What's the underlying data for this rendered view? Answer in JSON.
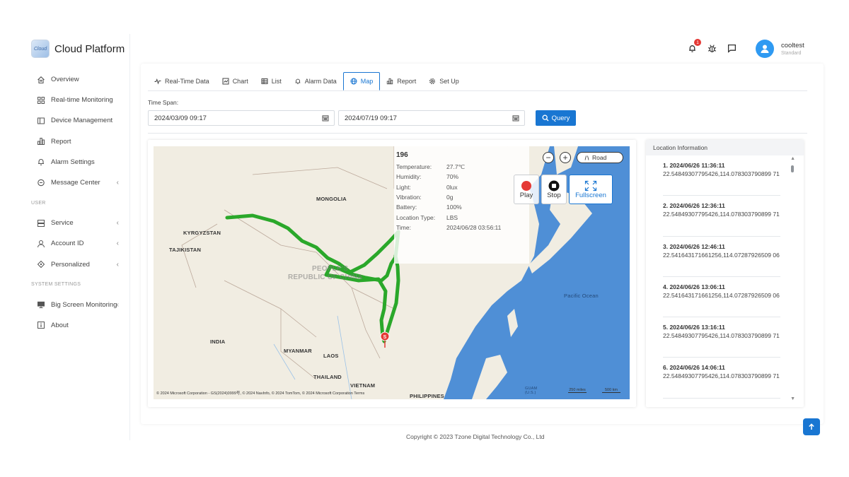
{
  "app": {
    "title": "Cloud Platform",
    "logo_text": "Cloud"
  },
  "sidebar": {
    "items": [
      {
        "label": "Overview",
        "icon": "home-icon"
      },
      {
        "label": "Real-time Monitoring",
        "icon": "grid-icon"
      },
      {
        "label": "Device Management",
        "icon": "device-icon"
      },
      {
        "label": "Report",
        "icon": "bar-chart-icon"
      },
      {
        "label": "Alarm Settings",
        "icon": "bell-icon"
      },
      {
        "label": "Message Center",
        "icon": "message-icon"
      }
    ],
    "section_user": "USER",
    "user_items": [
      {
        "label": "Service",
        "icon": "server-icon"
      },
      {
        "label": "Account ID",
        "icon": "person-icon"
      },
      {
        "label": "Personalized",
        "icon": "brush-icon"
      }
    ],
    "section_system": "SYSTEM SETTINGS",
    "system_items": [
      {
        "label": "Big Screen Monitoring",
        "icon": "monitor-icon"
      },
      {
        "label": "About",
        "icon": "info-icon"
      }
    ]
  },
  "header": {
    "notification_count": "1",
    "user_name": "cooltest",
    "user_role": "Standard"
  },
  "tabs": [
    {
      "label": "Real-Time Data",
      "icon": "pulse-icon"
    },
    {
      "label": "Chart",
      "icon": "chart-icon"
    },
    {
      "label": "List",
      "icon": "table-icon"
    },
    {
      "label": "Alarm Data",
      "icon": "bell-icon"
    },
    {
      "label": "Map",
      "icon": "globe-icon",
      "active": true
    },
    {
      "label": "Report",
      "icon": "bar-chart-icon"
    },
    {
      "label": "Set Up",
      "icon": "gear-icon"
    }
  ],
  "filter": {
    "time_span_label": "Time Span:",
    "start": "2024/03/09 09:17",
    "end": "2024/07/19 09:17",
    "query_label": "Query"
  },
  "map": {
    "road_label": "Road",
    "play_label": "Play",
    "stop_label": "Stop",
    "fullscreen_label": "Fullscreen",
    "start_marker": "S",
    "labels": {
      "mongolia": "MONGOLIA",
      "kyrgyzstan": "KYRGYZSTAN",
      "tajikistan": "TAJIKISTAN",
      "china_1": "PEOPLE'S",
      "china_2": "REPUBLIC OF CHINA",
      "india": "INDIA",
      "myanmar": "MYANMAR",
      "laos": "LAOS",
      "thailand": "THAILAND",
      "vietnam": "VIETNAM",
      "philippines": "PHILIPPINES",
      "pacific": "Pacific Ocean",
      "guam": "GUAM (U.S.)"
    },
    "attribution": "© 2024 Microsoft Corporation - GS(2024)0999号, © 2024 NavInfo, © 2024 TomTom, © 2024 Microsoft Corporation  Terms",
    "scale_miles": "250 miles",
    "scale_km": "500 km",
    "popup": {
      "id": "196",
      "rows": [
        {
          "k": "Temperature:",
          "v": "27.7℃"
        },
        {
          "k": "Humidity:",
          "v": "70%"
        },
        {
          "k": "Light:",
          "v": "0lux"
        },
        {
          "k": "Vibration:",
          "v": "0g"
        },
        {
          "k": "Battery:",
          "v": "100%"
        },
        {
          "k": "Location Type:",
          "v": "LBS"
        },
        {
          "k": "Time:",
          "v": "2024/06/28 03:56:11"
        }
      ]
    },
    "colors": {
      "water": "#4f8fd6",
      "land": "#f1ede2",
      "track": "#2aa82a"
    }
  },
  "location_info": {
    "title": "Location Information",
    "items": [
      {
        "time": "1. 2024/06/26 11:36:11",
        "coord": "22.54849307795426,114.078303790899 71"
      },
      {
        "time": "2. 2024/06/26 12:36:11",
        "coord": "22.54849307795426,114.078303790899 71"
      },
      {
        "time": "3. 2024/06/26 12:46:11",
        "coord": "22.541643171661256,114.07287926509 06"
      },
      {
        "time": "4. 2024/06/26 13:06:11",
        "coord": "22.541643171661256,114.07287926509 06"
      },
      {
        "time": "5. 2024/06/26 13:16:11",
        "coord": "22.54849307795426,114.078303790899 71"
      },
      {
        "time": "6. 2024/06/26 14:06:11",
        "coord": "22.54849307795426,114.078303790899 71"
      }
    ]
  },
  "footer": {
    "copyright": "Copyright © 2023 Tzone Digital Technology Co., Ltd"
  }
}
